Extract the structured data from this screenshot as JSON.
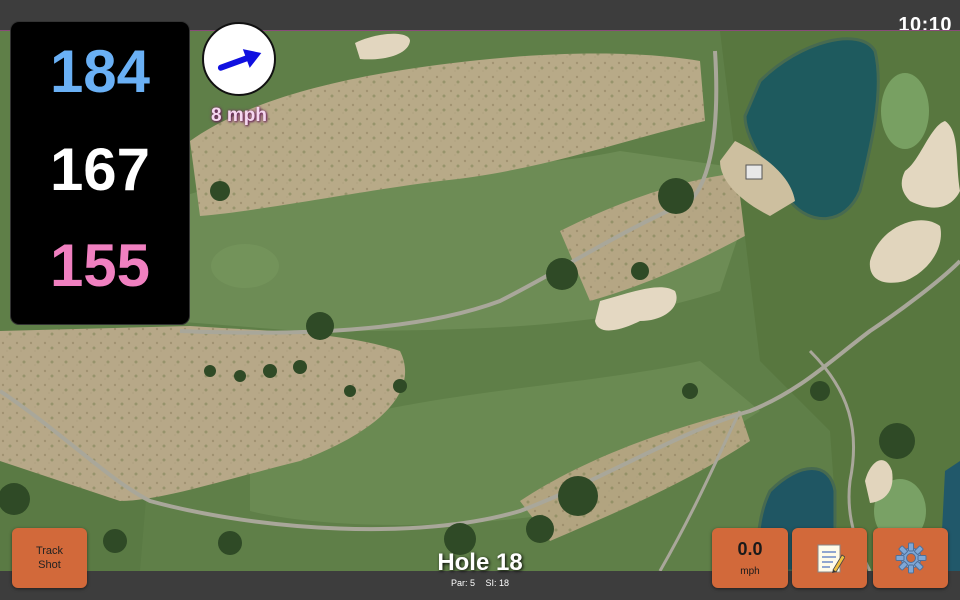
{
  "status_bar": {
    "time": "10:10"
  },
  "yardage": {
    "back": "184",
    "middle": "167",
    "front": "155"
  },
  "wind": {
    "speed_label": "8 mph",
    "direction_icon": "arrow-right-icon",
    "arrow_color": "#1010e0"
  },
  "buttons": {
    "track_shot_line1": "Track",
    "track_shot_line2": "Shot",
    "speed_value": "0.0",
    "speed_unit": "mph",
    "notes_icon": "notepad-icon",
    "settings_icon": "gear-icon"
  },
  "hole": {
    "title": "Hole 18",
    "par": "Par: 5",
    "stroke_index": "SI: 18"
  },
  "colors": {
    "accent_button": "#d2693a",
    "yardage_back": "#6ab0f5",
    "yardage_middle": "#ffffff",
    "yardage_front": "#f080c0"
  }
}
